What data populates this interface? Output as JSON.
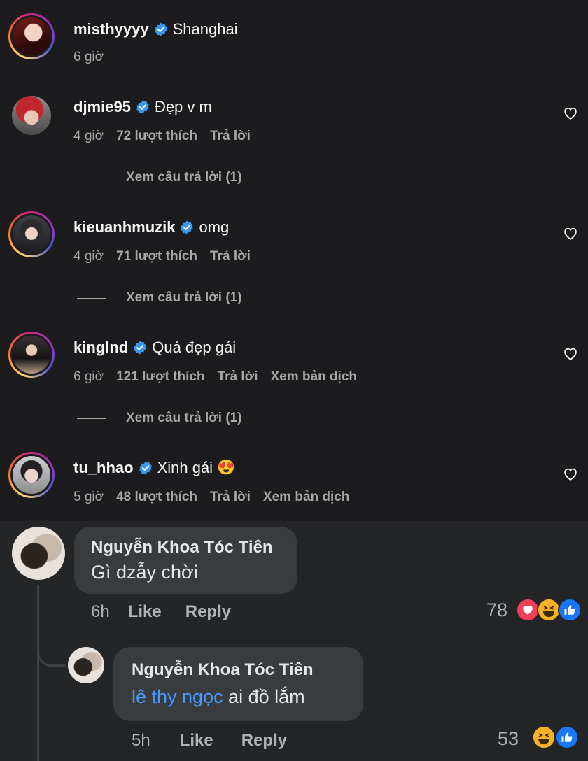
{
  "ig_comments": [
    {
      "username": "misthyyyy",
      "text": "Shanghai",
      "time": "6 giờ",
      "likes": "",
      "reply": "",
      "translate": "",
      "view_replies": ""
    },
    {
      "username": "djmie95",
      "text": "Đẹp v m",
      "time": "4 giờ",
      "likes": "72 lượt thích",
      "reply": "Trả lời",
      "translate": "",
      "view_replies": "Xem câu trả lời (1)"
    },
    {
      "username": "kieuanhmuzik",
      "text": "omg",
      "time": "4 giờ",
      "likes": "71 lượt thích",
      "reply": "Trả lời",
      "translate": "",
      "view_replies": "Xem câu trả lời (1)"
    },
    {
      "username": "kinglnd",
      "text": "Quá đẹp gái",
      "time": "6 giờ",
      "likes": "121 lượt thích",
      "reply": "Trả lời",
      "translate": "Xem bản dịch",
      "view_replies": "Xem câu trả lời (1)"
    },
    {
      "username": "tu_hhao",
      "text": "Xinh gái",
      "emoji": "😍",
      "time": "5 giờ",
      "likes": "48 lượt thích",
      "reply": "Trả lời",
      "translate": "Xem bản dịch",
      "view_replies": ""
    }
  ],
  "fb_comments": [
    {
      "name": "Nguyễn Khoa Tóc Tiên",
      "tag": "",
      "text": "Gì dzẫy chời",
      "time": "6h",
      "like": "Like",
      "reply": "Reply",
      "reaction_count": "78",
      "reactions": [
        "heart",
        "haha",
        "like"
      ]
    },
    {
      "name": "Nguyễn Khoa Tóc Tiên",
      "tag": "lê thy ngọc",
      "text": " ai đồ lắm",
      "time": "5h",
      "like": "Like",
      "reply": "Reply",
      "reaction_count": "53",
      "reactions": [
        "haha",
        "like"
      ]
    }
  ],
  "colors": {
    "ig_bg": "#1c1c1f",
    "fb_bg": "#242526",
    "verified": "#3897f0",
    "fb_link": "#4599ff",
    "muted": "#a8a8a8"
  }
}
